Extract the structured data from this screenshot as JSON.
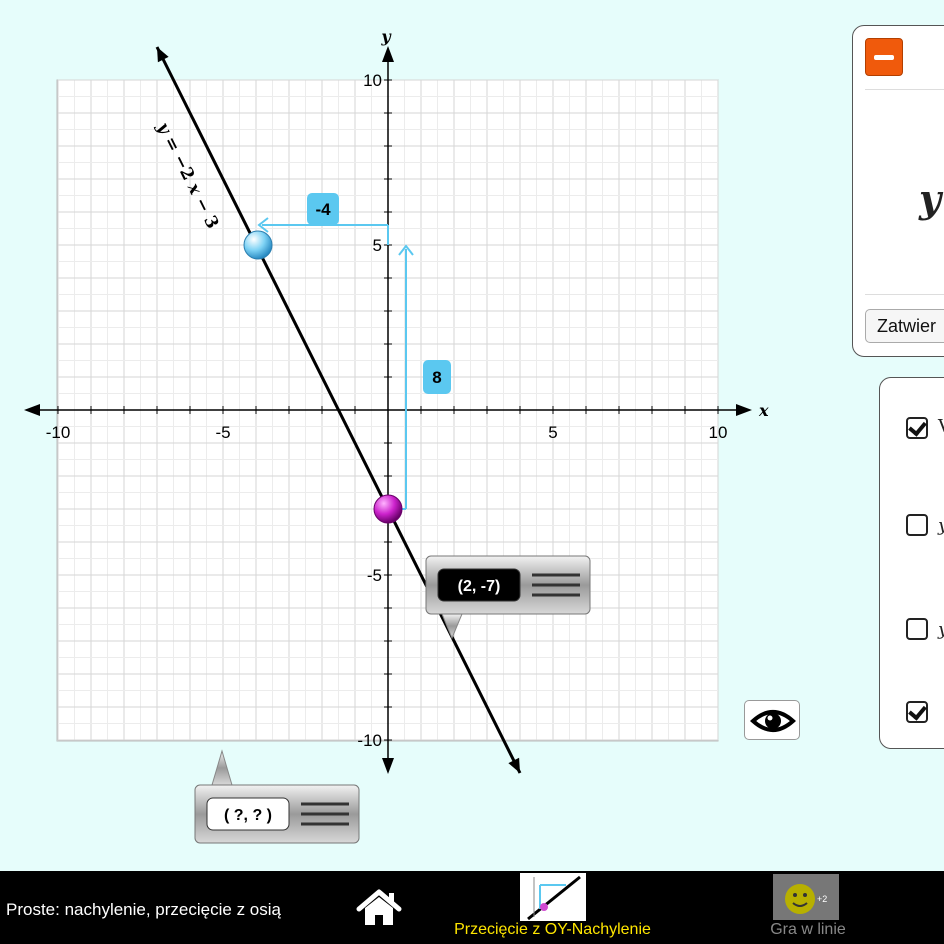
{
  "graph": {
    "x_axis_label": "x",
    "y_axis_label": "y",
    "x_range": [
      -10,
      10
    ],
    "y_range": [
      -10,
      10
    ],
    "x_tick_labels": [
      {
        "value": -10,
        "text": "-10"
      },
      {
        "value": -5,
        "text": "-5"
      },
      {
        "value": 5,
        "text": "5"
      },
      {
        "value": 10,
        "text": "10"
      }
    ],
    "y_tick_labels": [
      {
        "value": 10,
        "text": "10"
      },
      {
        "value": 5,
        "text": "5"
      },
      {
        "value": -5,
        "text": "-5"
      },
      {
        "value": -10,
        "text": "-10"
      }
    ],
    "line": {
      "slope": -2,
      "intercept": -3,
      "from_x": -7,
      "to_x": 4,
      "label_parts": [
        "y",
        "=",
        "−2",
        "x",
        "−",
        "3"
      ]
    },
    "blue_point": {
      "x": -4,
      "y": 5,
      "color": "#7fd3f5"
    },
    "magenta_point": {
      "x": 0,
      "y": -3,
      "color": "#cc22cc"
    },
    "run_label": "-4",
    "rise_label": "8",
    "accent_color": "#5bc8f0",
    "slider_tooltip": {
      "text": "(2, -7)"
    },
    "point_tooltip": {
      "text": "( ?, ? )"
    }
  },
  "panel": {
    "equation_start": "y",
    "confirm_label": "Zatwier"
  },
  "options": {
    "items": [
      {
        "text": "V",
        "checked": true
      },
      {
        "text": "y",
        "checked": false
      },
      {
        "text": "y",
        "checked": false
      },
      {
        "text": "",
        "checked": true
      }
    ]
  },
  "footer": {
    "title": "Proste: nachylenie, przecięcie z osią",
    "tab_active": "Przecięcie z OY-Nachylenie",
    "tab_game": "Gra w linie",
    "game_badge": "+2"
  }
}
